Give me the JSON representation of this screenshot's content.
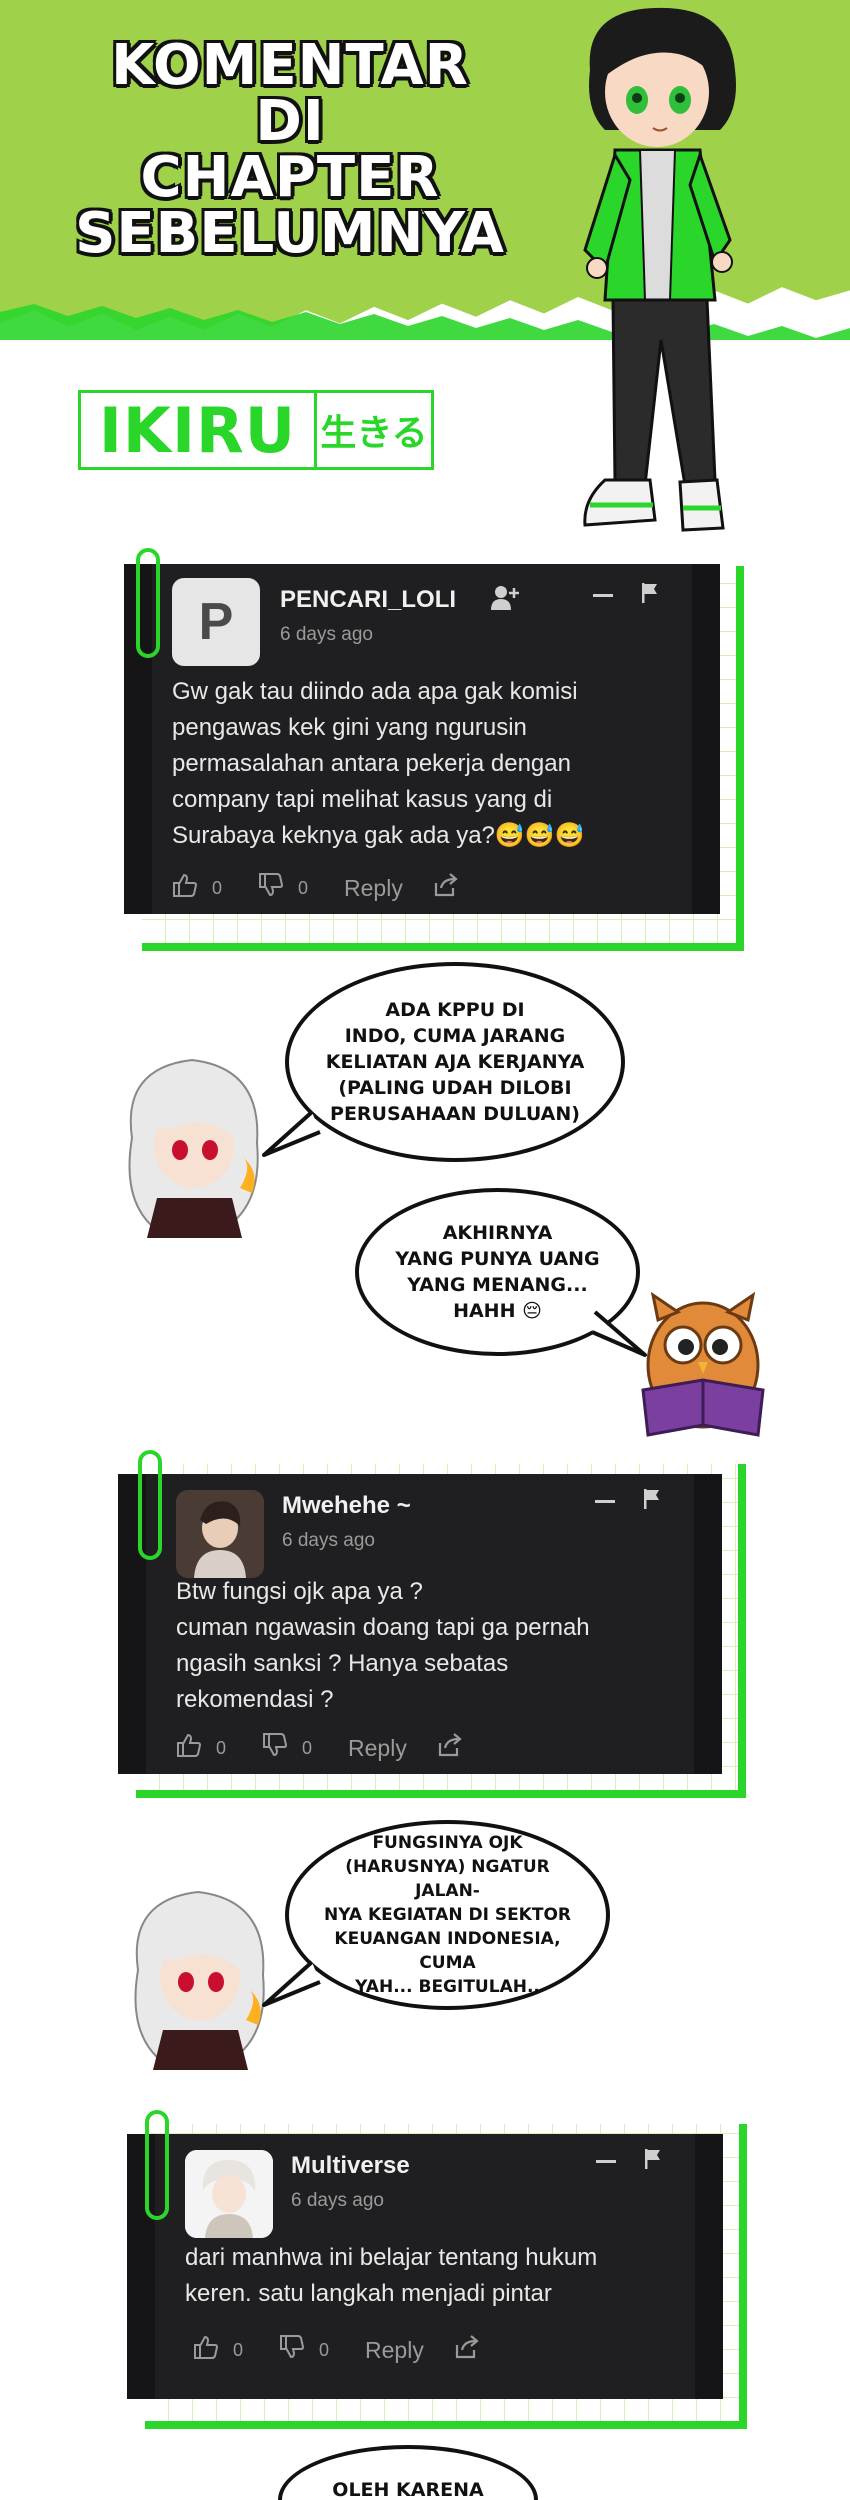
{
  "header": {
    "title_lines": [
      "KOMENTAR DI",
      "CHAPTER",
      "SEBELUMNYA"
    ],
    "logo_text": "IKIRU",
    "logo_jp": "生きる"
  },
  "comments": [
    {
      "username": "PENCARI_LOLI",
      "avatar_letter": "P",
      "time": "6 days ago",
      "text": "Gw gak tau diindo ada apa gak komisi pengawas kek gini yang ngurusin permasalahan antara pekerja dengan company tapi melihat kasus yang di Surabaya keknya gak ada ya?😅😅😅",
      "likes": "0",
      "dislikes": "0",
      "reply_label": "Reply"
    },
    {
      "username": "Mwehehe ~",
      "time": "6 days ago",
      "text": "Btw fungsi ojk apa ya ?\ncuman ngawasin doang tapi ga pernah ngasih sanksi ? Hanya sebatas rekomendasi ?",
      "likes": "0",
      "dislikes": "0",
      "reply_label": "Reply"
    },
    {
      "username": "Multiverse",
      "time": "6 days ago",
      "text": "dari manhwa ini belajar tentang hukum keren. satu langkah menjadi pintar",
      "likes": "0",
      "dislikes": "0",
      "reply_label": "Reply"
    }
  ],
  "bubbles": [
    "ADA KPPU DI\nINDO, CUMA JARANG\nKELIATAN AJA KERJANYA\n(PALING UDAH DILOBI\nPERUSAHAAN DULUAN)",
    "AKHIRNYA\nYANG PUNYA UANG\nYANG MENANG...\nHAHH 😔",
    "FUNGSINYA OJK\n(HARUSNYA) NGATUR JALAN-\nNYA KEGIATAN DI SEKTOR\nKEUANGAN INDONESIA, CUMA\nYAH... BEGITULAH..",
    "OLEH KARENA"
  ],
  "icons": {
    "like": "thumbs-up-icon",
    "dislike": "thumbs-down-icon",
    "share": "share-icon",
    "minimize": "minus-icon",
    "flag": "flag-icon",
    "follow": "add-user-icon"
  },
  "colors": {
    "header_green": "#9fd24a",
    "accent_green": "#2bd62b",
    "card_bg": "#1f1f21"
  }
}
